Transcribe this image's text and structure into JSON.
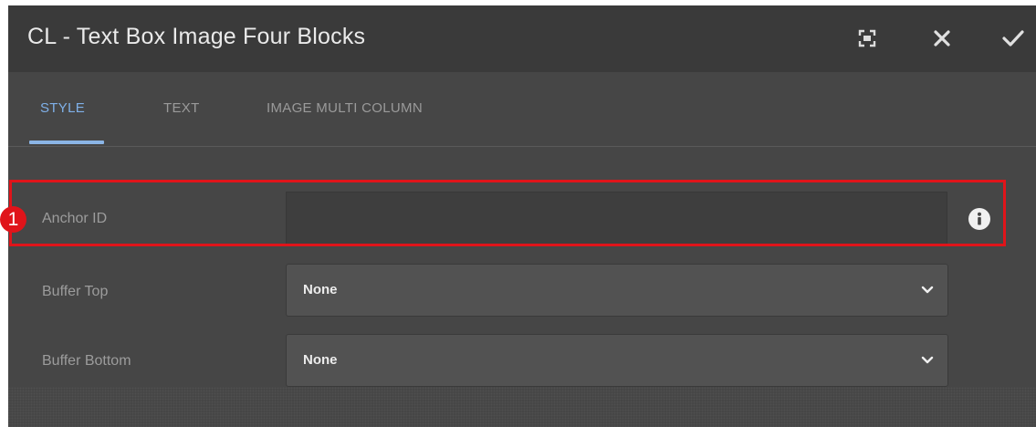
{
  "dialog": {
    "title": "CL - Text Box Image Four Blocks",
    "icons": [
      "fullscreen-icon",
      "close-icon",
      "checkmark-icon"
    ]
  },
  "tabs": [
    {
      "label": "STYLE",
      "active": true
    },
    {
      "label": "TEXT",
      "active": false
    },
    {
      "label": "IMAGE MULTI COLUMN",
      "active": false
    }
  ],
  "fields": {
    "anchor_id": {
      "label": "Anchor ID",
      "value": "",
      "info_icon": "info-icon"
    },
    "buffer_top": {
      "label": "Buffer Top",
      "value": "None"
    },
    "buffer_bottom": {
      "label": "Buffer Bottom",
      "value": "None"
    }
  },
  "annotation": {
    "number": "1",
    "color": "#e0141a"
  },
  "colors": {
    "background": "#464646",
    "titlebar": "#3a3a3a",
    "accent": "#7fb0e8"
  }
}
